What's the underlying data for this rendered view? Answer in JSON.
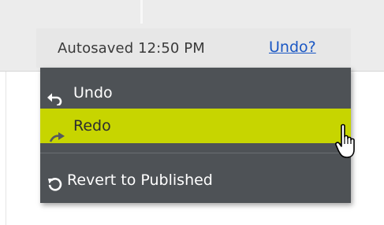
{
  "autosave": {
    "status": "Autosaved 12:50 PM",
    "undo_link": "Undo?"
  },
  "menu": {
    "items": [
      {
        "label": "Undo",
        "icon": "undo-arrow-icon",
        "highlighted": false
      },
      {
        "label": "Redo",
        "icon": "redo-arrow-icon",
        "highlighted": true
      },
      {
        "label": "Revert to Published",
        "icon": "revert-circle-icon",
        "highlighted": false
      }
    ]
  },
  "colors": {
    "menu_bg": "#4e5256",
    "highlight": "#c7d500",
    "link": "#1a57c4",
    "menu_text": "#ffffff"
  },
  "cursor": "hand-pointer-icon"
}
